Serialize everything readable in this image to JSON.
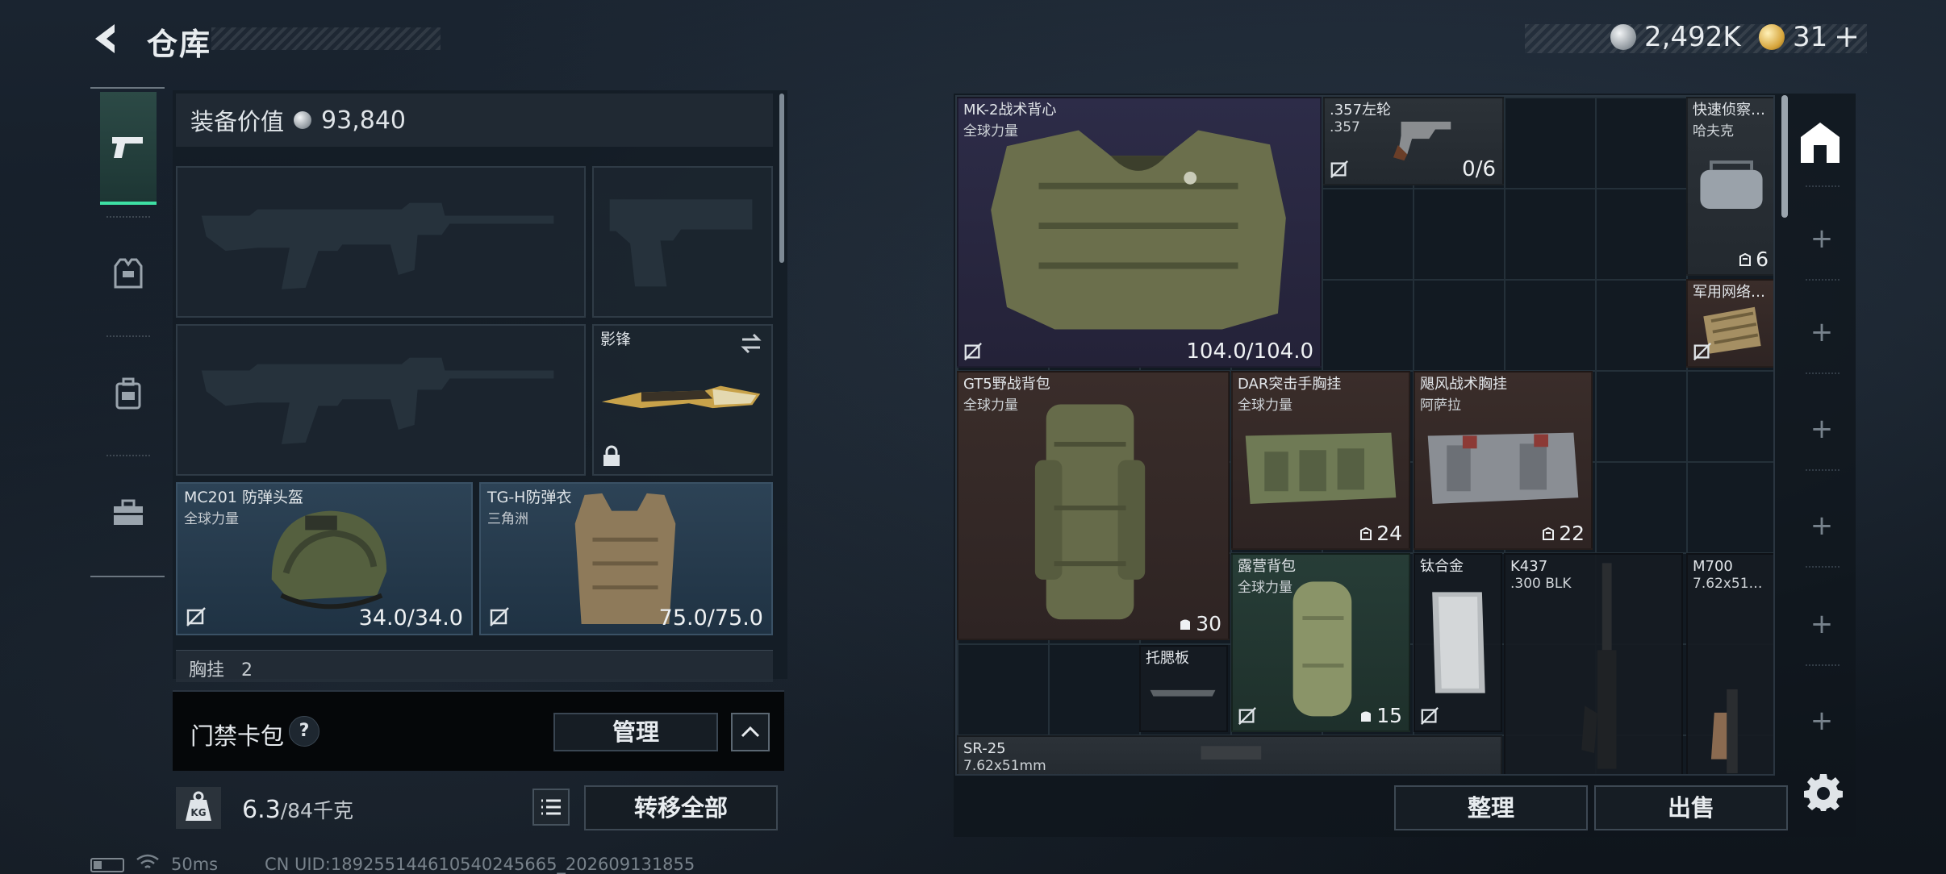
{
  "header": {
    "title": "仓库"
  },
  "currency": {
    "silver": "2,492K",
    "gold": "31"
  },
  "nav": {
    "items": [
      "weapons-icon",
      "armor-icon",
      "backpack-icon",
      "toolbox-icon"
    ],
    "active": 0
  },
  "loadout": {
    "value_label": "装备价值",
    "value": "93,840",
    "melee": {
      "name": "影锋"
    },
    "helmet": {
      "name": "MC201 防弹头盔",
      "sub": "全球力量",
      "durability": "34.0/34.0"
    },
    "armor": {
      "name": "TG-H防弹衣",
      "sub": "三角洲",
      "durability": "75.0/75.0"
    },
    "chest_rig": {
      "label": "胸挂",
      "count": "2"
    }
  },
  "keycard": {
    "label": "门禁卡包",
    "help": "?",
    "manage": "管理"
  },
  "weight": {
    "current": "6.3",
    "max": "/84千克"
  },
  "buttons": {
    "transfer_all": "转移全部",
    "sort": "整理",
    "sell": "出售"
  },
  "status": {
    "ping": "50ms",
    "uid": "CN UID:18925514461054024566­5_202609131855"
  },
  "stash": {
    "items": [
      {
        "name": "MK-2战术背心",
        "sub": "全球力量",
        "value": "104.0/104.0",
        "kind": "durability"
      },
      {
        "name": ".357左轮",
        "sub": ".357",
        "value": "0/6",
        "kind": "ammo"
      },
      {
        "name": "快速侦察…",
        "sub": "哈夫克",
        "value": "6",
        "kind": "capacity"
      },
      {
        "name": "军用网络…",
        "sub": "",
        "value": "",
        "kind": "none"
      },
      {
        "name": "GT5野战背包",
        "sub": "全球力量",
        "value": "30",
        "kind": "capacity"
      },
      {
        "name": "DAR突击手胸挂",
        "sub": "全球力量",
        "value": "24",
        "kind": "capacity"
      },
      {
        "name": "飓风战术胸挂",
        "sub": "阿萨拉",
        "value": "22",
        "kind": "capacity"
      },
      {
        "name": "露营背包",
        "sub": "全球力量",
        "value": "15",
        "kind": "capacity"
      },
      {
        "name": "钛合金",
        "sub": "",
        "value": "",
        "kind": "none"
      },
      {
        "name": "K437",
        "sub": ".300 BLK",
        "value": "",
        "kind": "none"
      },
      {
        "name": "M700",
        "sub": "7.62x51…",
        "value": "",
        "kind": "none"
      },
      {
        "name": "托腮板",
        "sub": "",
        "value": "",
        "kind": "none"
      },
      {
        "name": "SR-25",
        "sub": "7.62x51mm",
        "value": "",
        "kind": "none"
      }
    ]
  },
  "colors": {
    "accent": "#3ee0a4",
    "rarity_purple": "#2d2c48",
    "rarity_brown": "#3a2d2a",
    "rarity_green": "#273d37"
  }
}
